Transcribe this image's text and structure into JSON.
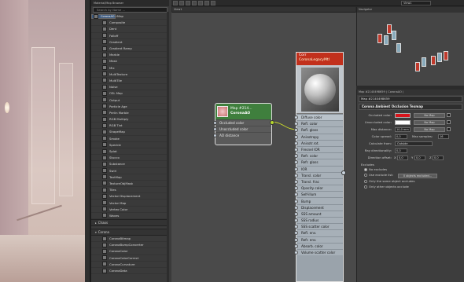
{
  "toolbar": {
    "view_dropdown": "View1"
  },
  "view_tab": "View1",
  "browser": {
    "title": "Material/Map Browser",
    "search_placeholder": "Search by Name ...",
    "maps_items": [
      "ColorMap",
      "Composite",
      "Dent",
      "Falloff",
      "Gradient",
      "Gradient Ramp",
      "Marble",
      "Mask",
      "Mix",
      "MultiTexture",
      "MultiTile",
      "Noise",
      "OSL Map",
      "Output",
      "Particle Age",
      "Perlin Marble",
      "RGB Multiply",
      "RGB Tint",
      "ShapeMap",
      "Smoke",
      "Speckle",
      "Splat",
      "Stucco",
      "Substance",
      "Swirl",
      "TextMap",
      "TextureObjMask",
      "Tiles",
      "Vector Displacement",
      "Vector Map",
      "Vertex Color",
      "Waves"
    ],
    "category_chaos": "Chaos",
    "category_corona": "Corona",
    "corona_items": [
      "CoronaAO",
      "CoronaBitmap",
      "CoronaBumpConverter",
      "CoronaColor",
      "CoronaColorCorrect",
      "CoronaCurvature",
      "CoronaData"
    ]
  },
  "ao_node": {
    "title": "Map #214...",
    "subtitle": "CoronaAO",
    "slots": [
      "Occluded color",
      "Unoccluded color",
      "AO distance"
    ]
  },
  "mat_node": {
    "title": "Corr",
    "subtitle": "CoronaLegacyMtl",
    "slots": [
      "Diffuse color",
      "Refl. color",
      "Refl. gloss",
      "Anisotropy",
      "Anisotr.rot.",
      "Fresnel IOR",
      "Refr. color",
      "Refr. gloss",
      "IOR",
      "Transl. color",
      "Transl. frac",
      "Opacity color",
      "Self-illum",
      "Bump",
      "Displacement",
      "SSS amount",
      "SSS radius",
      "SSS scatter color",
      "Refl. env.",
      "Refr. env.",
      "Absorb. color",
      "Volume scatter color"
    ]
  },
  "navigator": {
    "title": "Navigator"
  },
  "params": {
    "title": "Map #2140498659 ( CoronaAO )",
    "name_field": "Map #2140498659",
    "rollout": "Corona Ambient Occlusion Texmap",
    "occluded_label": "Occluded color:",
    "unoccluded_label": "Unoccluded color:",
    "no_map": "No Map",
    "max_distance_label": "Max distance:",
    "max_distance_value": "10,0 mm",
    "color_spread_label": "Color spread:",
    "color_spread_value": "0,0",
    "max_samples_label": "Max samples:",
    "max_samples_value": "16",
    "calculate_label": "Calculate from:",
    "calculate_value": "Outside",
    "ray_dir_label": "Ray directionality:",
    "ray_dir_value": "0,0",
    "direction_offset_label": "Direction offset:",
    "x_label": "X",
    "y_label": "Y",
    "z_label": "Z",
    "x_value": "0,0",
    "y_value": "0,0",
    "z_value": "0,0",
    "excludes_label": "Excludes",
    "no_excludes": "No excludes",
    "use_exclude_list": "Use exclude list:",
    "objects_excluded": "0 objects excluded...",
    "only_same": "Only the same object occludes",
    "only_other": "Only other objects occlude",
    "occluded_color": "#d8141b",
    "unoccluded_color": "#ffffff"
  }
}
